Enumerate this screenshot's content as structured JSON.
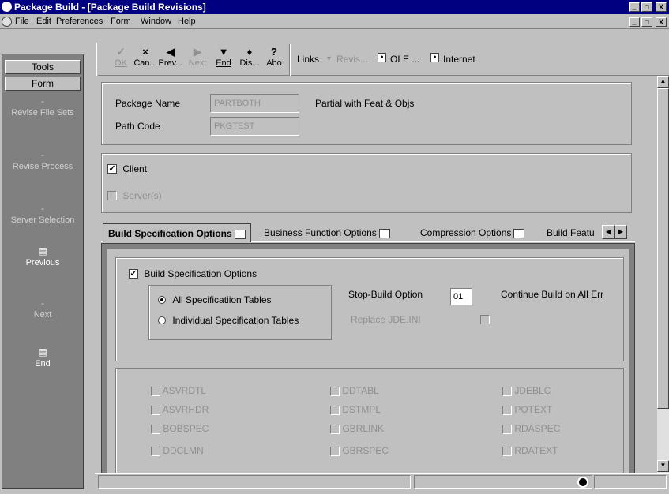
{
  "window": {
    "title": "Package Build - [Package Build Revisions]",
    "controls": [
      "_",
      "□",
      "X"
    ]
  },
  "menu": {
    "file": "File",
    "edit": "Edit",
    "preferences": "Preferences",
    "form": "Form",
    "window": "Window",
    "help": "Help"
  },
  "leftpanel": {
    "tools_label": "Tools",
    "form_label": "Form",
    "items": [
      {
        "label": "Revise File Sets",
        "icon": "dash-icon"
      },
      {
        "label": "Revise Process",
        "icon": "dash-icon"
      },
      {
        "label": "Server Selection",
        "icon": "dash-icon"
      },
      {
        "label": "Previous",
        "icon": "page-stack-icon"
      },
      {
        "label": "Next",
        "icon": "dash-icon"
      },
      {
        "label": "End",
        "icon": "page-stack-icon"
      }
    ]
  },
  "toolbar": {
    "ok": "OK",
    "cancel": "Can...",
    "prev": "Prev...",
    "next": "Next",
    "end": "End",
    "display": "Dis...",
    "about": "Abo",
    "links": "Links",
    "revise": "Revis...",
    "ole": "OLE ...",
    "internet": "Internet"
  },
  "header": {
    "package_name_label": "Package Name",
    "package_name_value": "PARTBOTH",
    "package_desc": "Partial with Feat & Objs",
    "path_code_label": "Path Code",
    "path_code_value": "PKGTEST"
  },
  "targets": {
    "client_label": "Client",
    "client_checked": true,
    "server_label": "Server(s)",
    "server_checked": false
  },
  "tabs": [
    {
      "label": "Build Specification Options",
      "active": true
    },
    {
      "label": "Business Function Options",
      "active": false
    },
    {
      "label": "Compression Options",
      "active": false
    },
    {
      "label": "Build Featu",
      "active": false
    }
  ],
  "buildspec": {
    "group_label": "Build Specification Options",
    "group_checked": true,
    "all_tables_label": "All Specificatiion Tables",
    "individual_tables_label": "Individual Specification Tables",
    "selected": "all",
    "stop_build_label": "Stop-Build Option",
    "stop_build_value": "01",
    "stop_build_desc": "Continue Build on All Err",
    "replace_ini_label": "Replace JDE.INI"
  },
  "spec_tables": {
    "col1": [
      "ASVRDTL",
      "ASVRHDR",
      "BOBSPEC",
      "DDCLMN"
    ],
    "col2": [
      "DDTABL",
      "DSTMPL",
      "GBRLINK",
      "GBRSPEC"
    ],
    "col3": [
      "JDEBLC",
      "POTEXT",
      "RDASPEC",
      "RDATEXT"
    ]
  }
}
